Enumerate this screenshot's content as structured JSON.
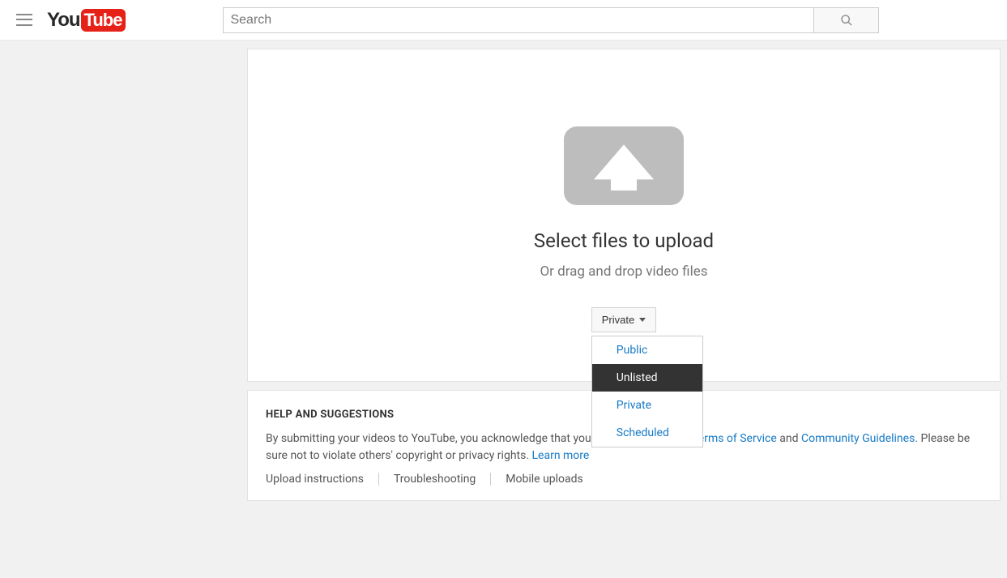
{
  "header": {
    "logo_you": "You",
    "logo_tube": "Tube",
    "search_placeholder": "Search"
  },
  "upload": {
    "title": "Select files to upload",
    "subtitle": "Or drag and drop video files",
    "privacy_selected": "Private",
    "privacy_options": [
      "Public",
      "Unlisted",
      "Private",
      "Scheduled"
    ],
    "privacy_highlighted": "Unlisted"
  },
  "help": {
    "title": "HELP AND SUGGESTIONS",
    "text_pre": "By submitting your videos to YouTube, you acknowledge that you agree to YouTube's ",
    "tos": "Terms of Service",
    "text_and": " and ",
    "guidelines": "Community Guidelines",
    "text_post": ". Please be sure not to violate others' copyright or privacy rights. ",
    "learn_more": "Learn more",
    "links": [
      "Upload instructions",
      "Troubleshooting",
      "Mobile uploads"
    ]
  }
}
